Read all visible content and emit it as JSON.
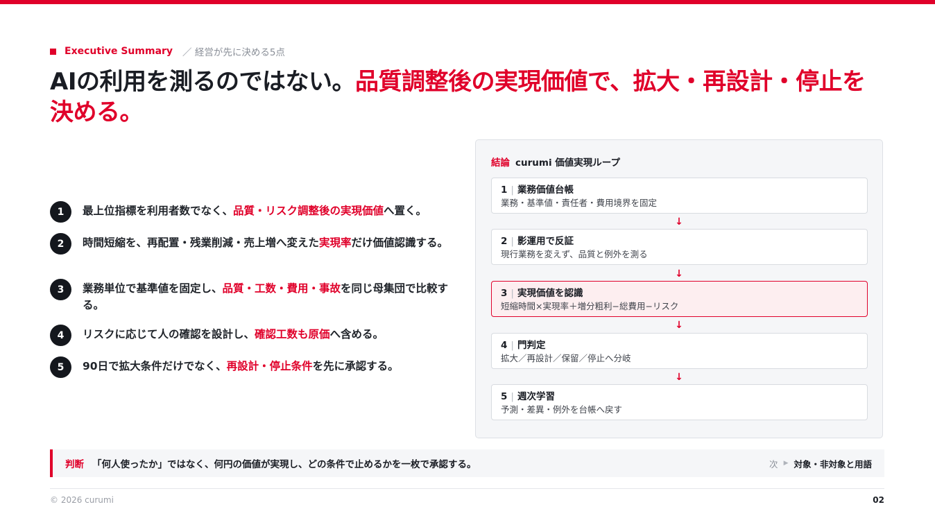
{
  "eyebrow": {
    "tag": "Executive Summary",
    "sub": "／ 経営が先に決める5点"
  },
  "title": {
    "part1": "AIの利用を測るのではない。",
    "part2": "品質調整後の実現価値で、拡大・再設計・停止を決める。"
  },
  "points": [
    {
      "num": "1",
      "pre": "最上位指標を利用者数でなく、",
      "hl": "品質・リスク調整後の実現価値",
      "post": "へ置く。"
    },
    {
      "num": "2",
      "pre": "時間短縮を、再配置・残業削減・売上増へ変えた",
      "hl": "実現率",
      "post": "だけ価値認識する。"
    },
    {
      "num": "3",
      "pre": "業務単位で基準値を固定し、",
      "hl": "品質・工数・費用・事故",
      "post": "を同じ母集団で比較する。"
    },
    {
      "num": "4",
      "pre": "リスクに応じて人の確認を設計し、",
      "hl": "確認工数も原価",
      "post": "へ含める。"
    },
    {
      "num": "5",
      "pre": "90日で拡大条件だけでなく、",
      "hl": "再設計・停止条件",
      "post": "を先に承認する。"
    }
  ],
  "panel": {
    "lead": "結論",
    "title": "curumi 価値実現ループ",
    "arrow": "↓",
    "steps": [
      {
        "num": "1",
        "sep": "|",
        "title": "業務価値台帳",
        "desc": "業務・基準値・責任者・費用境界を固定"
      },
      {
        "num": "2",
        "sep": "|",
        "title": "影運用で反証",
        "desc": "現行業務を変えず、品質と例外を測る"
      },
      {
        "num": "3",
        "sep": "|",
        "title": "実現価値を認識",
        "desc": "短縮時間×実現率＋増分粗利−総費用−リスク"
      },
      {
        "num": "4",
        "sep": "|",
        "title": "門判定",
        "desc": "拡大／再設計／保留／停止へ分岐"
      },
      {
        "num": "5",
        "sep": "|",
        "title": "週次学習",
        "desc": "予測・差異・例外を台帳へ戻す"
      }
    ]
  },
  "judgement": {
    "label": "判断",
    "text": "「何人使ったか」ではなく、何円の価値が実現し、どの条件で止めるかを一枚で承認する。",
    "next_label": "次",
    "next_value": "対象・非対象と用語"
  },
  "footer": {
    "copyright": "© 2026 curumi",
    "page": "02"
  },
  "colors": {
    "accent": "#e0002a",
    "ink": "#1a1d24",
    "panel_bg": "#f5f6f8",
    "active_step_bg": "#fdeef0"
  },
  "icons": {
    "eyebrow": "red-square-icon",
    "flow": "arrow-down-icon",
    "next": "triangle-right-icon"
  }
}
